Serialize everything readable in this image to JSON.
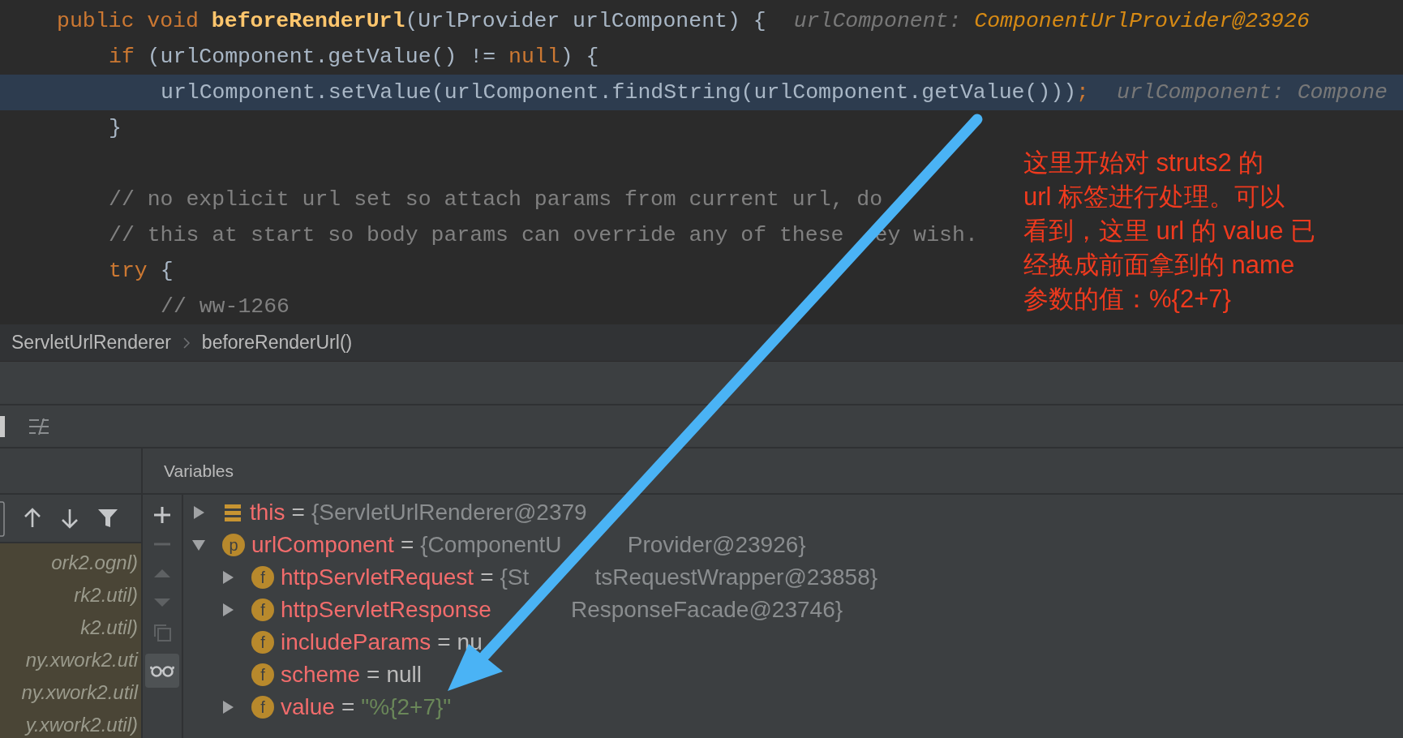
{
  "editor": {
    "lines": [
      {
        "tokens": [
          {
            "text": "public void ",
            "kind": "keyword"
          },
          {
            "text": "beforeRenderUrl",
            "kind": "method"
          },
          {
            "text": "(UrlProvider urlComponent) {",
            "kind": "plain"
          }
        ],
        "hint": {
          "label": "urlComponent: ",
          "value": "ComponentUrlProvider@23926"
        },
        "selected": false,
        "children": [
          {
            "tokens": [
              {
                "text": "if ",
                "kind": "keyword"
              },
              {
                "text": "(urlComponent.getValue() != ",
                "kind": "plain"
              },
              {
                "text": "null",
                "kind": "keyword"
              },
              {
                "text": ") {",
                "kind": "plain"
              }
            ],
            "selected": false,
            "children": [
              {
                "tokens": [
                  {
                    "text": "urlComponent.setValue(urlComponent.findString(urlComponent.getValue()))",
                    "kind": "plain"
                  },
                  {
                    "text": ";",
                    "kind": "keyword"
                  }
                ],
                "hint": {
                  "label": "urlComponent: Compone"
                },
                "selected": true
              }
            ]
          },
          {
            "tokens": [
              {
                "text": "}",
                "kind": "plain"
              }
            ],
            "selected": false
          },
          {
            "selected": false
          },
          {
            "tokens": [
              {
                "text": "// no explicit url set so attach params from current url, do",
                "kind": "comment"
              }
            ],
            "selected": false
          },
          {
            "segments": [
              [
                {
                  "text": "// this at start so body params can override any of these",
                  "kind": "comment"
                }
              ],
              [
                {
                  "text": "ey wish.",
                  "kind": "comment"
                }
              ]
            ],
            "selected": false
          },
          {
            "tokens": [
              {
                "text": "try ",
                "kind": "keyword"
              },
              {
                "text": "{",
                "kind": "plain"
              }
            ],
            "selected": false,
            "children": [
              {
                "tokens": [
                  {
                    "text": "// ww-1266",
                    "kind": "comment"
                  }
                ],
                "selected": false
              }
            ]
          }
        ]
      }
    ]
  },
  "annotation": {
    "lines": [
      "这里开始对 struts2 的",
      "url 标签进行处理。可以",
      "看到，这里 url 的 value 已",
      "经换成前面拿到的 name",
      "参数的值：%{2+7}"
    ]
  },
  "breadcrumb": [
    "ServletUrlRenderer",
    "beforeRenderUrl()"
  ],
  "frames": {
    "items": [
      "ork2.ognl)",
      "rk2.util)",
      "k2.util)",
      "ny.xwork2.uti",
      "ny.xwork2.util",
      "y.xwork2.util)"
    ]
  },
  "variables": {
    "title": "Variables",
    "items": [
      {
        "kind": "this",
        "name": "this",
        "op": "=",
        "value": "{ServletUrlRenderer@2379",
        "color": "#8a8d8f",
        "expanded": false
      },
      {
        "kind": "param",
        "badge": "p",
        "name": "urlComponent",
        "op": "=",
        "value": [
          "{ComponentU",
          "Provider@23926}"
        ],
        "color": "#8a8d8f",
        "expanded": true,
        "children": [
          {
            "kind": "field",
            "badge": "f",
            "name": "httpServletRequest",
            "op": "=",
            "value": [
              "{St",
              "tsRequestWrapper@23858}"
            ],
            "color": "#8a8d8f",
            "expanded": false
          },
          {
            "kind": "field",
            "badge": "f",
            "name": "httpServletResponse",
            "value": [
              "ResponseFacade@23746}"
            ],
            "color": "#8a8d8f",
            "expanded": false
          },
          {
            "kind": "field",
            "badge": "f",
            "name": "includeParams",
            "op": "=",
            "value": "nu",
            "color": "#bbbbbb"
          },
          {
            "kind": "field",
            "badge": "f",
            "name": "scheme",
            "op": "=",
            "value": "null",
            "color": "#bbbbbb"
          },
          {
            "kind": "field",
            "badge": "f",
            "name": "value",
            "op": "=",
            "value": "\"%{2+7}\"",
            "color": "#6a8759",
            "expanded": false
          }
        ]
      }
    ]
  }
}
